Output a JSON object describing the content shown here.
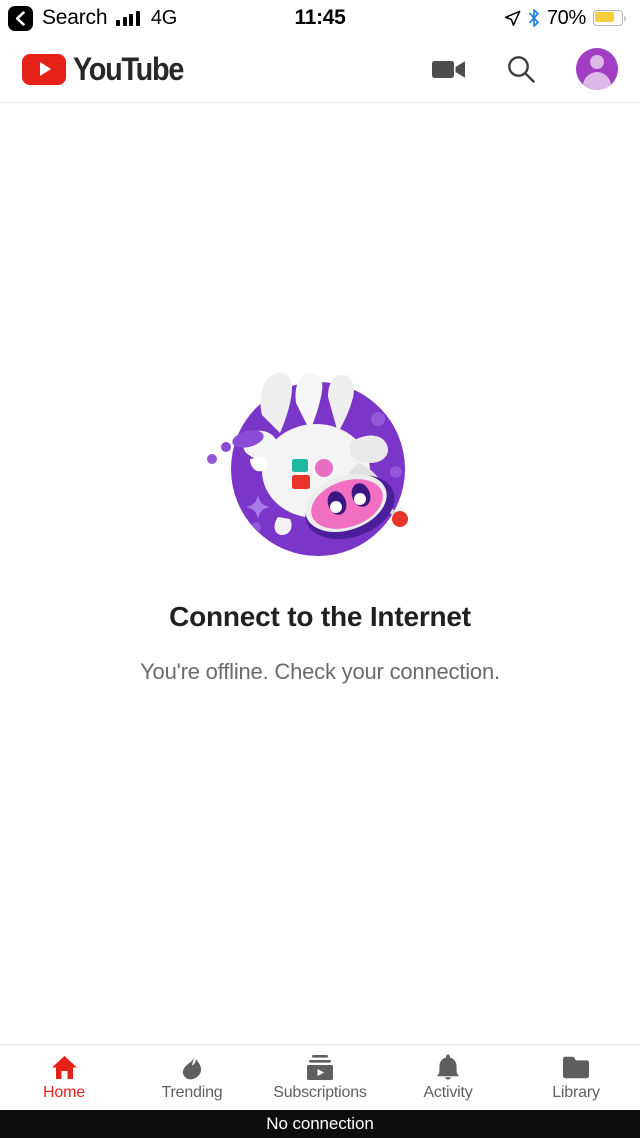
{
  "status_bar": {
    "back_label": "Search",
    "back_icon": "chevron-left-icon",
    "signal_icon": "cellular-signal-icon",
    "network": "4G",
    "time": "11:45",
    "location_icon": "location-arrow-icon",
    "bluetooth_icon": "bluetooth-icon",
    "battery_percent": "70%",
    "battery_icon": "battery-icon",
    "battery_level": 70,
    "battery_color": "#F6CF3E"
  },
  "header": {
    "brand": "YouTube",
    "brand_color": "#E62117",
    "logo_icon": "youtube-logo-icon",
    "actions": [
      {
        "name": "camera-icon",
        "label": "Camera"
      },
      {
        "name": "search-icon",
        "label": "Search"
      },
      {
        "name": "avatar",
        "label": "Account"
      }
    ]
  },
  "empty_state": {
    "illustration": "offline-astronaut-cow-illustration",
    "title": "Connect to the Internet",
    "subtitle": "You're offline. Check your connection.",
    "colors": {
      "circle": "#7B35C9",
      "cow": "#F2F2F2",
      "snout": "#F06FC0",
      "helmet": "#4B1E9B",
      "tether_dot": "#E8342A",
      "patch_teal": "#1FB9A0",
      "patch_red": "#E8342A",
      "patch_pink": "#E86FC4",
      "sparkle": "#A97BE8"
    }
  },
  "tab_bar": {
    "active_index": 0,
    "active_color": "#E62117",
    "inactive_color": "#5f5f5f",
    "tabs": [
      {
        "label": "Home",
        "icon": "home-icon"
      },
      {
        "label": "Trending",
        "icon": "flame-icon"
      },
      {
        "label": "Subscriptions",
        "icon": "subscriptions-icon"
      },
      {
        "label": "Activity",
        "icon": "bell-icon"
      },
      {
        "label": "Library",
        "icon": "folder-icon"
      }
    ]
  },
  "toast": {
    "message": "No connection"
  }
}
